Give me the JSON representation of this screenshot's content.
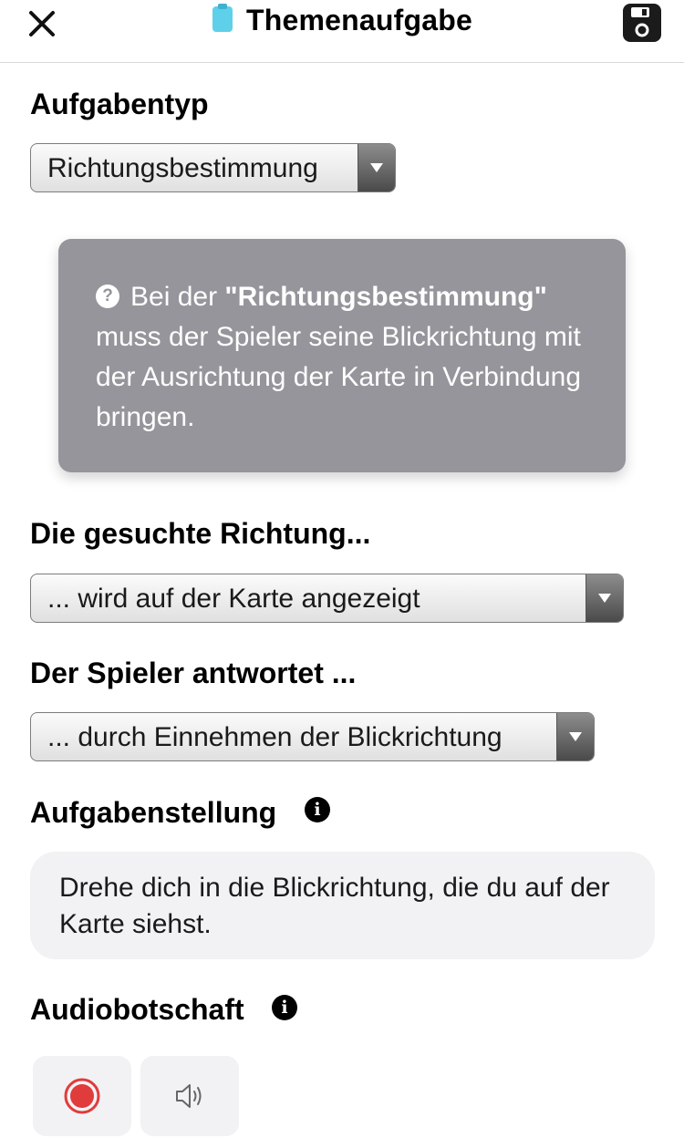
{
  "header": {
    "title": "Themenaufgabe",
    "close_icon": "close-icon",
    "title_icon": "clipboard-icon",
    "save_icon": "save-icon"
  },
  "task_type": {
    "label": "Aufgabentyp",
    "selected": "Richtungsbestimmung"
  },
  "hint": {
    "icon": "help-circle-icon",
    "prefix": "Bei der ",
    "emphasis": "\"Richtungsbestimmung\"",
    "suffix": " muss der Spieler seine Blickrichtung mit der Ausrichtung der Karte in Verbindung bringen."
  },
  "direction": {
    "label": "Die gesuchte Richtung...",
    "selected": "... wird auf der Karte angezeigt"
  },
  "answer": {
    "label": "Der Spieler antwortet ...",
    "selected": "... durch Einnehmen der Blickrichtung"
  },
  "task_statement": {
    "label": "Aufgabenstellung",
    "text": "Drehe dich in die Blickrichtung, die du auf der Karte siehst."
  },
  "audio": {
    "label": "Audiobotschaft",
    "record_icon": "record-icon",
    "play_icon": "speaker-icon"
  },
  "colors": {
    "record": "#e03c3c",
    "hint_bg": "#95959b",
    "textbox_bg": "#f2f2f4"
  }
}
